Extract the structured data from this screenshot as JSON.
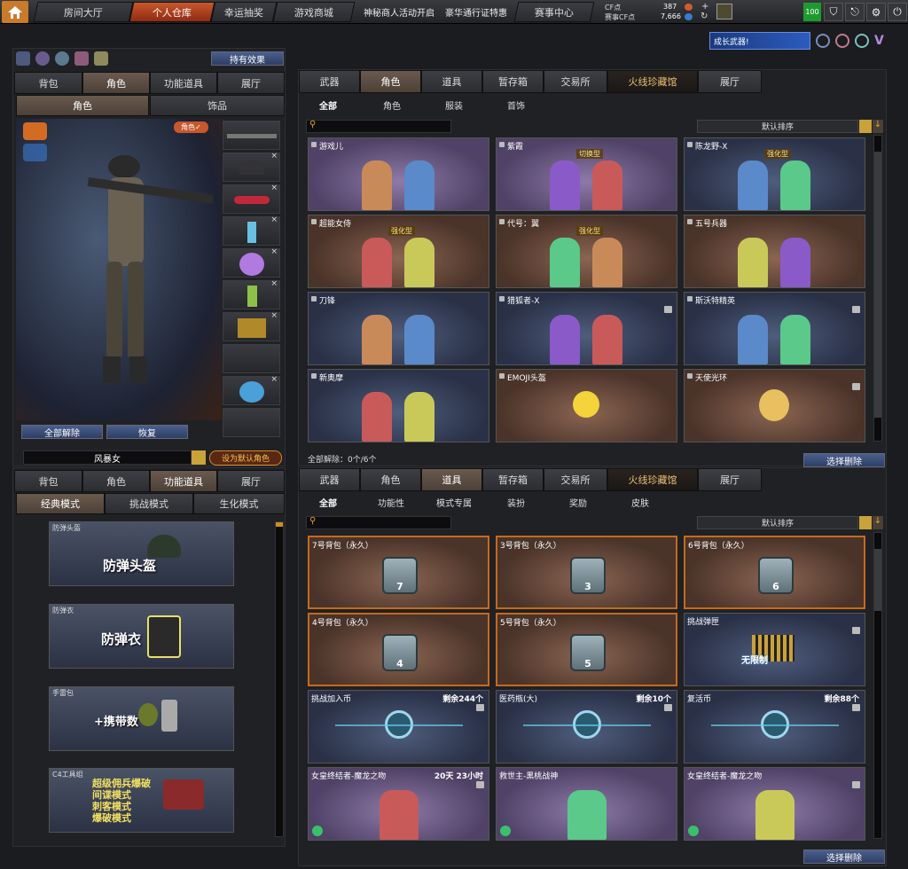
{
  "top_nav": {
    "tabs": [
      "房间大厅",
      "个人仓库",
      "幸运抽奖",
      "游戏商城"
    ],
    "links": [
      "神秘商人活动开启",
      "豪华通行证特惠"
    ],
    "match_center": "赛事中心",
    "cf_label": "CF点",
    "cf_value": "387",
    "match_cf_label": "赛事CF点",
    "match_cf_value": "7,666",
    "level": "100"
  },
  "char_panel": {
    "hold_effect": "持有效果",
    "tabs": [
      "背包",
      "角色",
      "功能道具",
      "展厅"
    ],
    "subtabs": [
      "角色",
      "饰品"
    ],
    "role_badge": "角色",
    "clear_all": "全部解除",
    "restore": "恢复",
    "char_name": "风暴女",
    "set_default": "设为默认角色"
  },
  "promo": {
    "label": "成长武器!"
  },
  "store_top": {
    "tabs": [
      "武器",
      "角色",
      "道具",
      "暂存箱",
      "交易所",
      "火线珍藏馆",
      "展厅"
    ],
    "subtabs": [
      "全部",
      "角色",
      "服装",
      "首饰"
    ],
    "sort": "默认排序",
    "cards": [
      {
        "name": "游戏儿",
        "style": "purple",
        "badge": ""
      },
      {
        "name": "紫霞",
        "style": "purple",
        "badge": "切换型"
      },
      {
        "name": "陈龙野-X",
        "style": "navy",
        "badge": "强化型"
      },
      {
        "name": "超能女侍",
        "style": "brown",
        "badge": "强化型"
      },
      {
        "name": "代号：翼",
        "style": "brown",
        "badge": "强化型"
      },
      {
        "name": "五号兵器",
        "style": "brown",
        "badge": ""
      },
      {
        "name": "刀锋",
        "style": "navy",
        "badge": ""
      },
      {
        "name": "猎狐者-X",
        "style": "navy",
        "badge": ""
      },
      {
        "name": "斯沃特精英",
        "style": "navy",
        "badge": ""
      },
      {
        "name": "新奥摩",
        "style": "navy",
        "badge": ""
      },
      {
        "name": "EMOJI头盔",
        "style": "brown",
        "badge": ""
      },
      {
        "name": "天使光环",
        "style": "brown",
        "badge": ""
      }
    ],
    "footer": "全部解除：0个/6个",
    "select_delete": "选择删除"
  },
  "func_panel": {
    "tabs": [
      "背包",
      "角色",
      "功能道具",
      "展厅"
    ],
    "modes": [
      "经典模式",
      "挑战模式",
      "生化模式"
    ],
    "items": [
      {
        "label": "防弹头盔",
        "big": "防弹头盔"
      },
      {
        "label": "防弹衣",
        "big": "防弹衣"
      },
      {
        "label": "手雷包",
        "big": "+携带数"
      },
      {
        "label": "C4工具组",
        "lines": [
          "超级佣兵爆破",
          "间谍模式",
          "刺客模式",
          "爆破模式"
        ]
      }
    ]
  },
  "store_bottom": {
    "tabs": [
      "武器",
      "角色",
      "道具",
      "暂存箱",
      "交易所",
      "火线珍藏馆",
      "展厅"
    ],
    "subtabs": [
      "全部",
      "功能性",
      "模式专属",
      "装扮",
      "奖励",
      "皮肤"
    ],
    "sort": "默认排序",
    "cards": [
      {
        "name": "7号背包（永久）",
        "count": "",
        "bag": "7"
      },
      {
        "name": "3号背包（永久）",
        "count": "",
        "bag": "3"
      },
      {
        "name": "6号背包（永久）",
        "count": "",
        "bag": "6"
      },
      {
        "name": "4号背包（永久）",
        "count": "",
        "bag": "4"
      },
      {
        "name": "5号背包（永久）",
        "count": "",
        "bag": "5"
      },
      {
        "name": "挑战弹匣",
        "count": "",
        "bag": "",
        "extra": "无限制"
      },
      {
        "name": "挑战加入币",
        "count": "剩余244个",
        "bag": ""
      },
      {
        "name": "医药瓶(大)",
        "count": "剩余10个",
        "bag": ""
      },
      {
        "name": "复活币",
        "count": "剩余88个",
        "bag": ""
      },
      {
        "name": "女皇终结者-魔龙之吻",
        "count": "20天 23小时",
        "bag": ""
      },
      {
        "name": "救世主-黑桃战神",
        "count": "",
        "bag": ""
      },
      {
        "name": "女皇终结者-魔龙之吻",
        "count": "",
        "bag": ""
      }
    ],
    "select_delete": "选择删除"
  }
}
